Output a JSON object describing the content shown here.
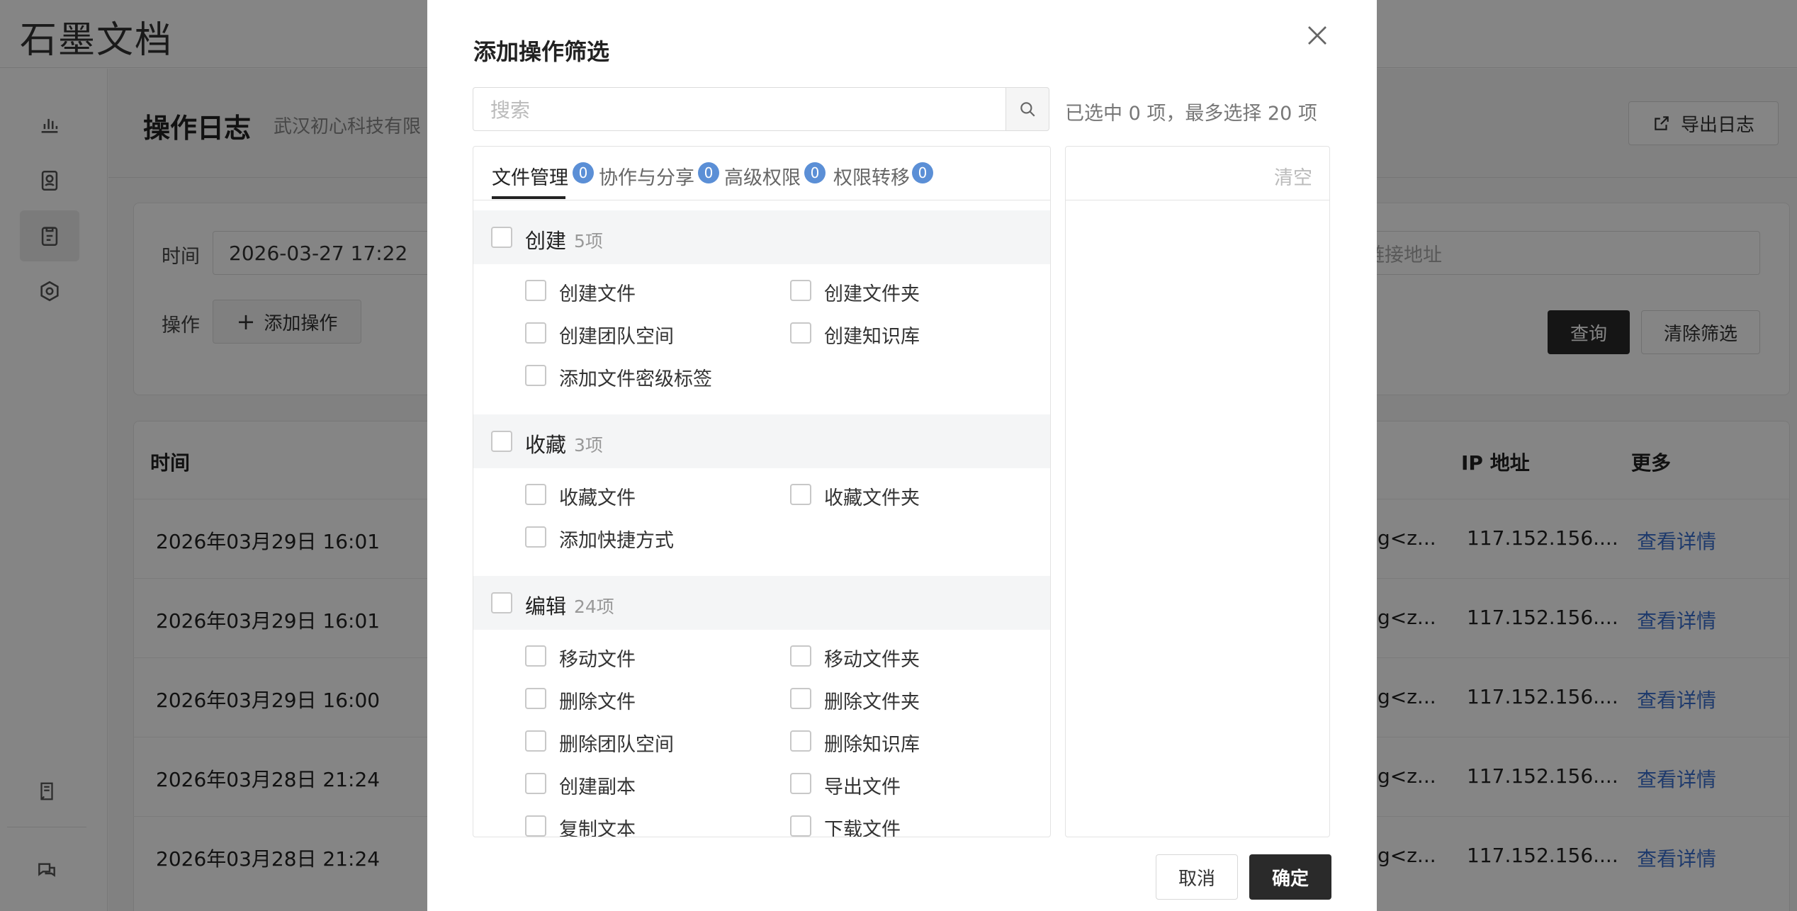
{
  "app": {
    "logo": "石墨文档"
  },
  "page": {
    "title": "操作日志",
    "subtitle": "武汉初心科技有限",
    "export_label": "导出日志"
  },
  "filters": {
    "time_label": "时间",
    "time_value": "2026-03-27 17:22",
    "op_label": "操作",
    "add_op_label": "添加操作",
    "link_placeholder": "链接地址",
    "query_label": "查询",
    "clear_label": "清除筛选"
  },
  "table": {
    "headers": {
      "time": "时间",
      "ip": "IP 地址",
      "more": "更多"
    },
    "rows": [
      {
        "time": "2026年03月29日 16:01",
        "user": "g<z...",
        "ip": "117.152.156....",
        "detail": "查看详情"
      },
      {
        "time": "2026年03月29日 16:01",
        "user": "g<z...",
        "ip": "117.152.156....",
        "detail": "查看详情"
      },
      {
        "time": "2026年03月29日 16:00",
        "user": "g<z...",
        "ip": "117.152.156....",
        "detail": "查看详情"
      },
      {
        "time": "2026年03月28日 21:24",
        "user": "g<z...",
        "ip": "117.152.156....",
        "detail": "查看详情"
      },
      {
        "time": "2026年03月28日 21:24",
        "user": "g<z...",
        "ip": "117.152.156....",
        "detail": "查看详情"
      }
    ]
  },
  "modal": {
    "title": "添加操作筛选",
    "search_placeholder": "搜索",
    "selected_hint": "已选中 0 项，最多选择 20 项",
    "clear_label": "清空",
    "cancel_label": "取消",
    "ok_label": "确定",
    "tabs": [
      {
        "label": "文件管理",
        "count": "0"
      },
      {
        "label": "协作与分享",
        "count": "0"
      },
      {
        "label": "高级权限",
        "count": "0"
      },
      {
        "label": "权限转移",
        "count": "0"
      }
    ],
    "groups": [
      {
        "name": "创建",
        "count": "5项",
        "items": [
          "创建文件",
          "创建文件夹",
          "创建团队空间",
          "创建知识库",
          "添加文件密级标签"
        ]
      },
      {
        "name": "收藏",
        "count": "3项",
        "items": [
          "收藏文件",
          "收藏文件夹",
          "添加快捷方式"
        ]
      },
      {
        "name": "编辑",
        "count": "24项",
        "items": [
          "移动文件",
          "移动文件夹",
          "删除文件",
          "删除文件夹",
          "删除团队空间",
          "删除知识库",
          "创建副本",
          "导出文件",
          "复制文本",
          "下载文件"
        ]
      }
    ]
  }
}
